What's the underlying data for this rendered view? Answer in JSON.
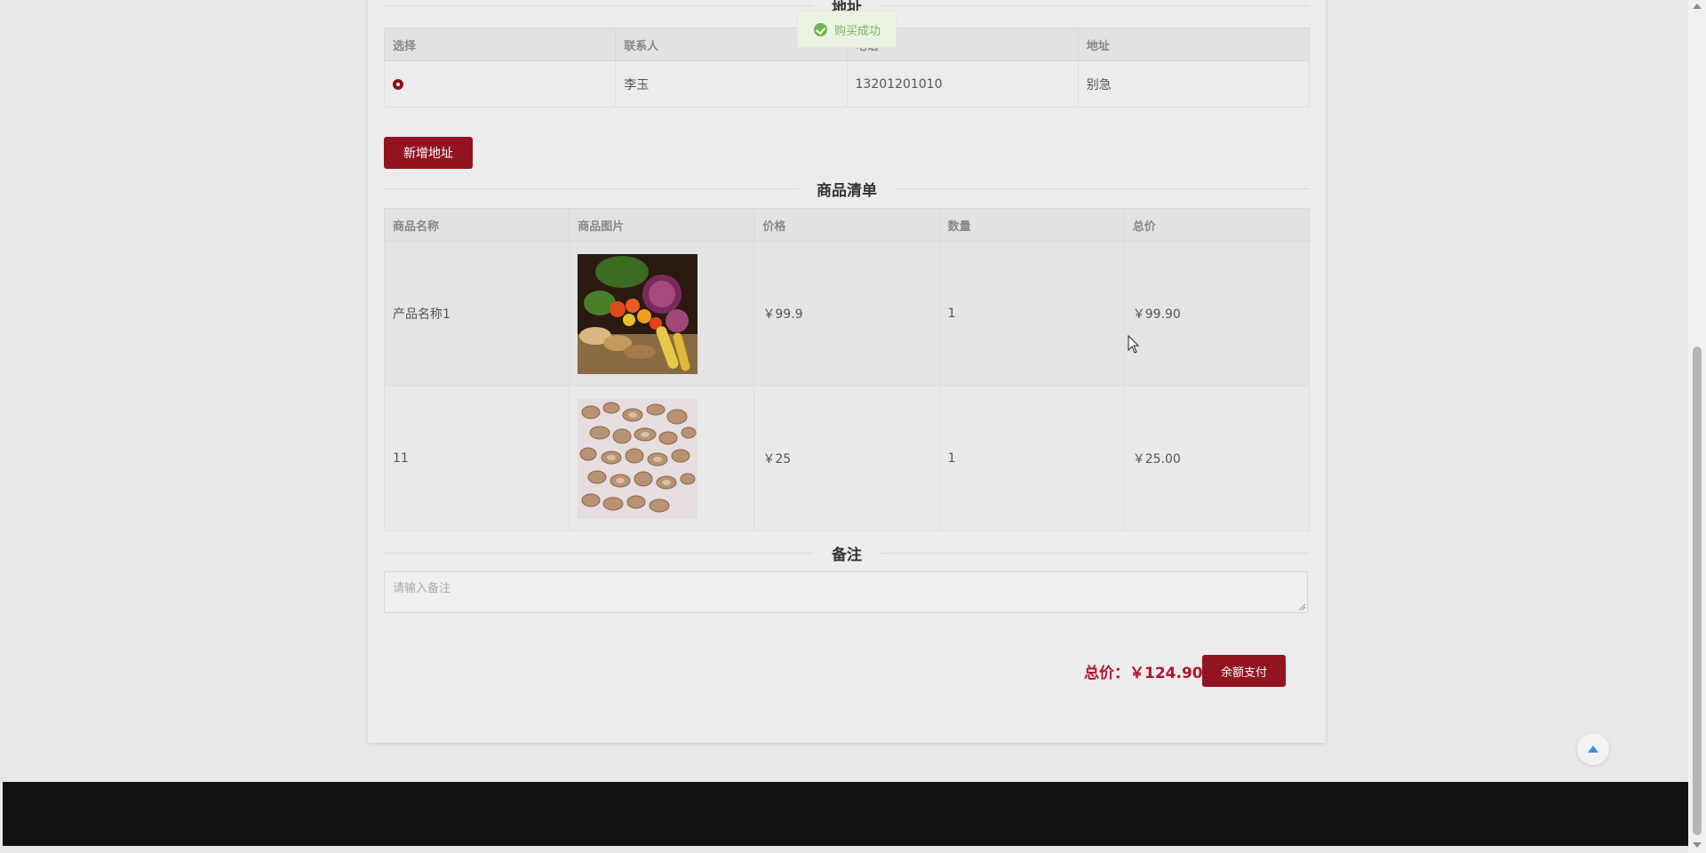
{
  "address_section": {
    "title": "地址",
    "headers": [
      "选择",
      "联系人",
      "电话",
      "地址"
    ],
    "rows": [
      {
        "selected": true,
        "contact": "李玉",
        "phone": "13201201010",
        "address": "别急"
      }
    ],
    "add_button": "新增地址"
  },
  "goods_section": {
    "title": "商品清单",
    "headers": [
      "商品名称",
      "商品图片",
      "价格",
      "数量",
      "总价"
    ],
    "rows": [
      {
        "name": "产品名称1",
        "image": "vegetables-grains-photo",
        "price": "￥99.9",
        "qty": "1",
        "total": "￥99.90"
      },
      {
        "name": "11",
        "image": "herbal-root-slices-photo",
        "price": "￥25",
        "qty": "1",
        "total": "￥25.00"
      }
    ]
  },
  "remark_section": {
    "title": "备注",
    "placeholder": "请输入备注"
  },
  "summary": {
    "total_label": "总价：￥124.90",
    "pay_button": "余额支付"
  },
  "toast": {
    "message": "购买成功",
    "icon": "check-circle-icon",
    "color": "#71b44c"
  },
  "colors": {
    "accent": "#931321",
    "total_text": "#b3122a"
  }
}
